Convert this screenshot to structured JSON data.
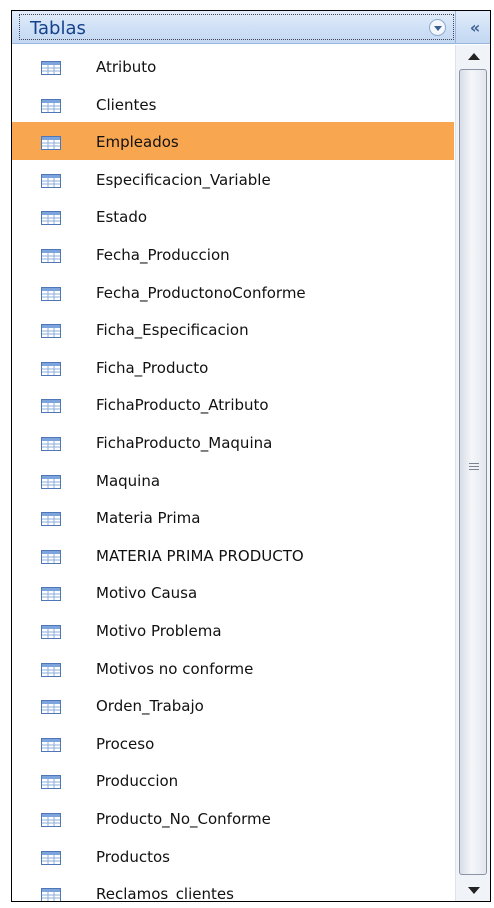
{
  "header": {
    "title": "Tablas",
    "collapse_glyph": "«",
    "dropdown_icon": "chevron-down-circle-icon"
  },
  "colors": {
    "header_text": "#15428b",
    "selected_bg": "#f9a650"
  },
  "selected_item": "Empleados",
  "items": [
    {
      "label": "Atributo"
    },
    {
      "label": "Clientes"
    },
    {
      "label": "Empleados"
    },
    {
      "label": "Especificacion_Variable"
    },
    {
      "label": "Estado"
    },
    {
      "label": "Fecha_Produccion"
    },
    {
      "label": "Fecha_ProductonoConforme"
    },
    {
      "label": "Ficha_Especificacion"
    },
    {
      "label": "Ficha_Producto"
    },
    {
      "label": "FichaProducto_Atributo"
    },
    {
      "label": "FichaProducto_Maquina"
    },
    {
      "label": "Maquina"
    },
    {
      "label": "Materia Prima"
    },
    {
      "label": "MATERIA PRIMA PRODUCTO"
    },
    {
      "label": "Motivo Causa"
    },
    {
      "label": "Motivo Problema"
    },
    {
      "label": "Motivos no conforme"
    },
    {
      "label": "Orden_Trabajo"
    },
    {
      "label": "Proceso"
    },
    {
      "label": "Produccion"
    },
    {
      "label": "Producto_No_Conforme"
    },
    {
      "label": "Productos"
    },
    {
      "label": "Reclamos_clientes"
    }
  ]
}
